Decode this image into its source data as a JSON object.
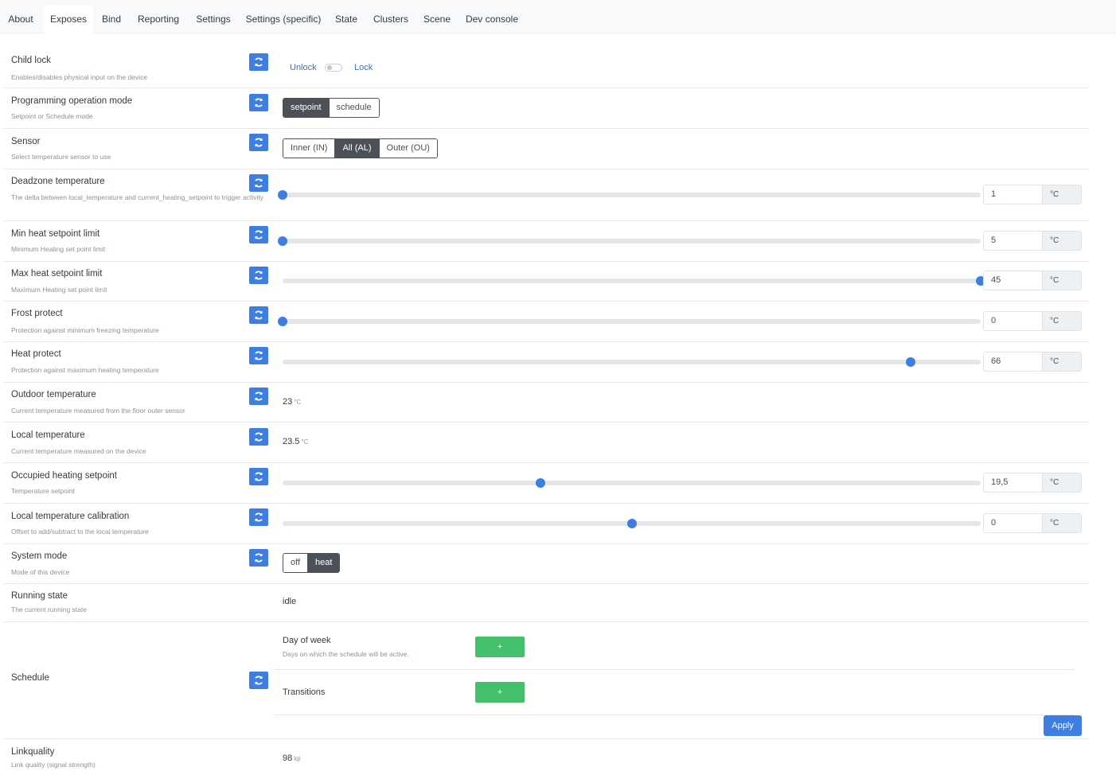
{
  "tabs": [
    {
      "label": "About"
    },
    {
      "label": "Exposes",
      "active": true
    },
    {
      "label": "Bind"
    },
    {
      "label": "Reporting"
    },
    {
      "label": "Settings"
    },
    {
      "label": "Settings (specific)"
    },
    {
      "label": "State"
    },
    {
      "label": "Clusters"
    },
    {
      "label": "Scene"
    },
    {
      "label": "Dev console"
    }
  ],
  "features": {
    "child_lock": {
      "label": "Child lock",
      "desc": "Enables/disables physical input on the device",
      "off_label": "Unlock",
      "on_label": "Lock",
      "value": "Unlock"
    },
    "programming_mode": {
      "label": "Programming operation mode",
      "desc": "Setpoint or Schedule mode",
      "options": [
        "setpoint",
        "schedule"
      ],
      "selected": "setpoint"
    },
    "sensor": {
      "label": "Sensor",
      "desc": "Select temperature sensor to use",
      "options": [
        "Inner (IN)",
        "All (AL)",
        "Outer (OU)"
      ],
      "selected": "All (AL)"
    },
    "deadzone": {
      "label": "Deadzone temperature",
      "desc": "The delta between local_temperature and current_heating_setpoint to trigger activity",
      "value": "1",
      "unit": "°C",
      "fraction": 0.0
    },
    "min_heat": {
      "label": "Min heat setpoint limit",
      "desc": "Minimum Heating set point limit",
      "value": "5",
      "unit": "°C",
      "fraction": 0.0
    },
    "max_heat": {
      "label": "Max heat setpoint limit",
      "desc": "Maximum Heating set point limit",
      "value": "45",
      "unit": "°C",
      "fraction": 1.0
    },
    "frost_protect": {
      "label": "Frost protect",
      "desc": "Protection against minimum freezing temperature",
      "value": "0",
      "unit": "°C",
      "fraction": 0.0
    },
    "heat_protect": {
      "label": "Heat protect",
      "desc": "Protection against maximum heating temperature",
      "value": "66",
      "unit": "°C",
      "fraction": 0.9
    },
    "outdoor_temp": {
      "label": "Outdoor temperature",
      "desc": "Current temperature measured from the floor outer sensor",
      "value": "23",
      "unit": "°C"
    },
    "local_temp": {
      "label": "Local temperature",
      "desc": "Current temperature measured on the device",
      "value": "23.5",
      "unit": "°C"
    },
    "occupied_setpoint": {
      "label": "Occupied heating setpoint",
      "desc": "Temperature setpoint",
      "value": "19,5",
      "unit": "°C",
      "fraction": 0.37
    },
    "calibration": {
      "label": "Local temperature calibration",
      "desc": "Offset to add/subtract to the local temperature",
      "value": "0",
      "unit": "°C",
      "fraction": 0.5
    },
    "system_mode": {
      "label": "System mode",
      "desc": "Mode of this device",
      "options": [
        "off",
        "heat"
      ],
      "selected": "heat"
    },
    "running_state": {
      "label": "Running state",
      "desc": "The current running state",
      "value": "idle"
    },
    "schedule": {
      "label": "Schedule",
      "day_of_week_label": "Day of week",
      "day_of_week_desc": "Days on which the schedule will be active.",
      "transitions_label": "Transitions",
      "add_label": "+",
      "apply_label": "Apply"
    },
    "linkquality": {
      "label": "Linkquality",
      "desc": "Link quality (signal strength)",
      "value": "98",
      "unit": "lqi"
    }
  },
  "colors": {
    "accent": "#3d7ee0",
    "success": "#44bf6c",
    "selected": "#4b5157"
  }
}
